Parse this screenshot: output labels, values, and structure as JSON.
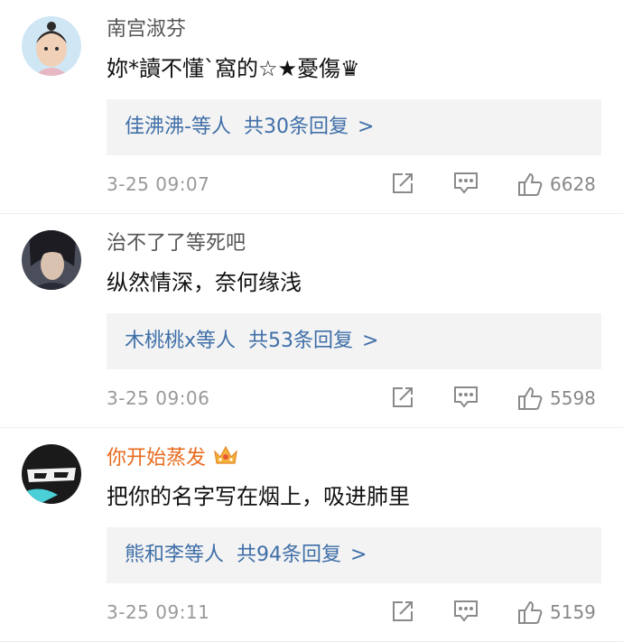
{
  "comments": [
    {
      "username": "南宫淑芬",
      "text": "妳*讀不懂`窩的☆★憂傷♛",
      "replies": {
        "users": "佳沸沸-等人",
        "count": "共30条回复",
        "chevron": ">"
      },
      "time": "3-25 09:07",
      "likes": "6628",
      "avatar_colors": [
        "#cfe6f5",
        "#f1d0b8",
        "#2b2b2b"
      ]
    },
    {
      "username": "治不了了等死吧",
      "text": "纵然情深，奈何缘浅",
      "replies": {
        "users": "木桃桃x等人",
        "count": "共53条回复",
        "chevron": ">"
      },
      "time": "3-25 09:06",
      "likes": "5598",
      "avatar_colors": [
        "#4a4e5a",
        "#d9c2b0",
        "#1c1c22"
      ]
    },
    {
      "username": "你开始蒸发",
      "username_color": "#e86b1f",
      "badge": "crown-icon",
      "text": "把你的名字写在烟上，吸进肺里",
      "replies": {
        "users": "熊和李等人",
        "count": "共94条回复",
        "chevron": ">"
      },
      "time": "3-25 09:11",
      "likes": "5159",
      "avatar_colors": [
        "#1a1a1a",
        "#4bd0d8",
        "#f2f2f2"
      ]
    }
  ],
  "colors": {
    "link": "#3f6fa8",
    "meta": "#999999",
    "reply_bg": "#f3f3f3",
    "accent_user": "#e86b1f"
  },
  "icons": {
    "share": "share-icon",
    "comment": "comment-icon",
    "like": "thumbs-up-icon"
  }
}
